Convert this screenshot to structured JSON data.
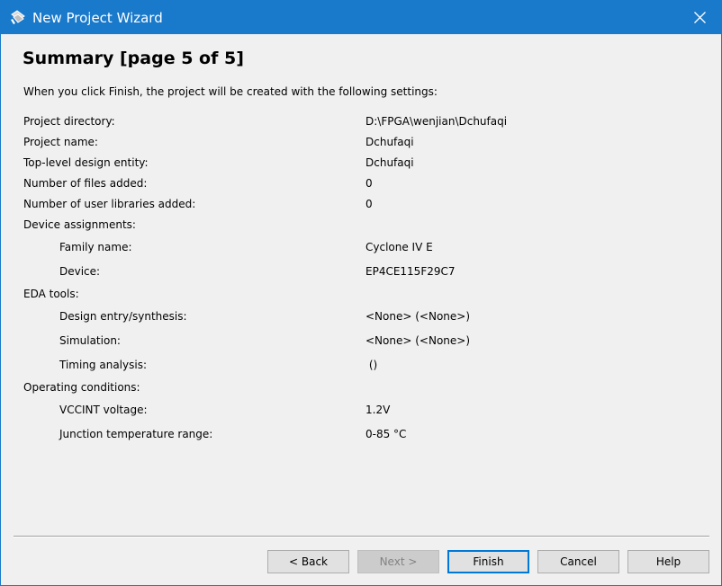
{
  "window": {
    "title": "New Project Wizard"
  },
  "page": {
    "heading": "Summary [page 5 of 5]",
    "intro": "When you click Finish, the project will be created with the following settings:"
  },
  "settings": {
    "project_directory": {
      "label": "Project directory:",
      "value": "D:\\FPGA\\wenjian\\Dchufaqi"
    },
    "project_name": {
      "label": "Project name:",
      "value": "Dchufaqi"
    },
    "top_level_entity": {
      "label": "Top-level design entity:",
      "value": "Dchufaqi"
    },
    "files_added": {
      "label": "Number of files added:",
      "value": "0"
    },
    "user_libraries_added": {
      "label": "Number of user libraries added:",
      "value": "0"
    },
    "device_assignments": {
      "label": "Device assignments:"
    },
    "family_name": {
      "label": "Family name:",
      "value": "Cyclone IV E"
    },
    "device": {
      "label": "Device:",
      "value": "EP4CE115F29C7"
    },
    "eda_tools": {
      "label": "EDA tools:"
    },
    "design_entry": {
      "label": "Design entry/synthesis:",
      "value": "<None> (<None>)"
    },
    "simulation": {
      "label": "Simulation:",
      "value": "<None> (<None>)"
    },
    "timing_analysis": {
      "label": "Timing analysis:",
      "value": " ()"
    },
    "operating_conditions": {
      "label": "Operating conditions:"
    },
    "vccint_voltage": {
      "label": "VCCINT voltage:",
      "value": "1.2V"
    },
    "junction_temp": {
      "label": "Junction temperature range:",
      "value": "0-85 °C"
    }
  },
  "buttons": {
    "back": "< Back",
    "next": "Next >",
    "finish": "Finish",
    "cancel": "Cancel",
    "help": "Help"
  },
  "colors": {
    "titlebar": "#1979ca",
    "default_button_border": "#0078d7"
  },
  "icons": {
    "title": "quartus-wizard-icon",
    "close": "close-icon"
  }
}
